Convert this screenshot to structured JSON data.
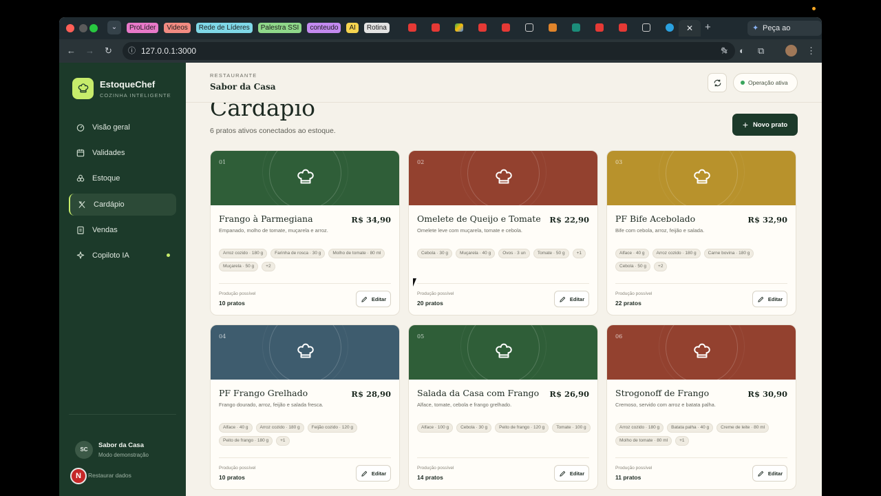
{
  "browser": {
    "tabs": [
      {
        "label": "ProLíder",
        "color": "#e879c9"
      },
      {
        "label": "Videos",
        "color": "#f28b82"
      },
      {
        "label": "Rede de Líderes",
        "color": "#7fd8e8"
      },
      {
        "label": "Palestra SSI",
        "color": "#8fd88a"
      },
      {
        "label": "conteudo",
        "color": "#c38af0"
      },
      {
        "label": "AI",
        "color": "#f5d44f"
      },
      {
        "label": "Rotina",
        "color": "#e3e3e3"
      }
    ],
    "url": "127.0.0.1:3000",
    "gemini_label": "Peça ao Gemini"
  },
  "sidebar": {
    "brand": "EstoqueChef",
    "tagline": "COZINHA INTELIGENTE",
    "items": [
      {
        "label": "Visão geral",
        "icon": "gauge-icon"
      },
      {
        "label": "Validades",
        "icon": "calendar-icon"
      },
      {
        "label": "Estoque",
        "icon": "boxes-icon"
      },
      {
        "label": "Cardápio",
        "icon": "utensils-icon",
        "active": true
      },
      {
        "label": "Vendas",
        "icon": "clipboard-icon"
      },
      {
        "label": "Copiloto IA",
        "icon": "sparkles-icon"
      }
    ],
    "user_initials": "SC",
    "user_name": "Sabor da Casa",
    "user_mode": "Modo demonstração",
    "restore_label": "Restaurar dados",
    "accent": "#c7ec6b"
  },
  "header": {
    "eyebrow": "RESTAURANTE",
    "restaurant": "Sabor da Casa",
    "status": "Operação ativa"
  },
  "page": {
    "title": "Cardápio",
    "subtitle": "6 pratos ativos conectados ao estoque.",
    "new_button": "Novo prato"
  },
  "dishes": [
    {
      "num": "01",
      "name": "Frango à Parmegiana",
      "price": "R$ 34,90",
      "desc": "Empanado, molho de tomate, muçarela e arroz.",
      "tags": [
        "Arroz cozido · 180 g",
        "Farinha de rosca · 30 g",
        "Molho de tomate · 80 ml",
        "Muçarela · 50 g",
        "+2"
      ],
      "prod_label": "Produção possível",
      "prod": "10 pratos",
      "edit": "Editar",
      "color": "#2f5e38"
    },
    {
      "num": "02",
      "name": "Omelete de Queijo e Tomate",
      "price": "R$ 22,90",
      "desc": "Omelete leve com muçarela, tomate e cebola.",
      "tags": [
        "Cebola · 30 g",
        "Muçarela · 40 g",
        "Ovos · 3 un",
        "Tomate · 50 g",
        "+1"
      ],
      "prod_label": "Produção possível",
      "prod": "20 pratos",
      "edit": "Editar",
      "color": "#93412f"
    },
    {
      "num": "03",
      "name": "PF Bife Acebolado",
      "price": "R$ 32,90",
      "desc": "Bife com cebola, arroz, feijão e salada.",
      "tags": [
        "Alface · 40 g",
        "Arroz cozido · 180 g",
        "Carne bovina · 180 g",
        "Cebola · 50 g",
        "+2"
      ],
      "prod_label": "Produção possível",
      "prod": "22 pratos",
      "edit": "Editar",
      "color": "#b8922c"
    },
    {
      "num": "04",
      "name": "PF Frango Grelhado",
      "price": "R$ 28,90",
      "desc": "Frango dourado, arroz, feijão e salada fresca.",
      "tags": [
        "Alface · 40 g",
        "Arroz cozido · 180 g",
        "Feijão cozido · 120 g",
        "Peito de frango · 180 g",
        "+1"
      ],
      "prod_label": "Produção possível",
      "prod": "10 pratos",
      "edit": "Editar",
      "color": "#3e5c6e"
    },
    {
      "num": "05",
      "name": "Salada da Casa com Frango",
      "price": "R$ 26,90",
      "desc": "Alface, tomate, cebola e frango grelhado.",
      "tags": [
        "Alface · 100 g",
        "Cebola · 30 g",
        "Peito de frango · 120 g",
        "Tomate · 100 g"
      ],
      "prod_label": "Produção possível",
      "prod": "14 pratos",
      "edit": "Editar",
      "color": "#2f5e38"
    },
    {
      "num": "06",
      "name": "Strogonoff de Frango",
      "price": "R$ 30,90",
      "desc": "Cremoso, servido com arroz e batata palha.",
      "tags": [
        "Arroz cozido · 180 g",
        "Batata palha · 40 g",
        "Creme de leite · 80 ml",
        "Molho de tomate · 80 ml",
        "+1"
      ],
      "prod_label": "Produção possível",
      "prod": "11 pratos",
      "edit": "Editar",
      "color": "#93412f"
    }
  ]
}
